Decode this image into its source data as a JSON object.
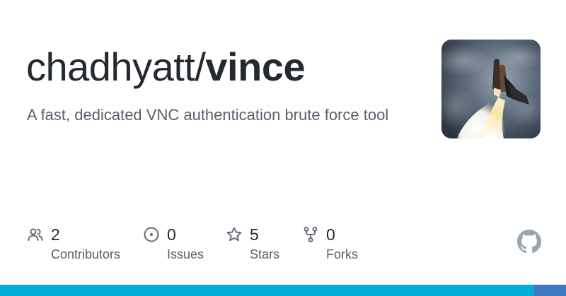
{
  "repo": {
    "owner": "chadhyatt/",
    "name": "vince",
    "description": "A fast, dedicated VNC authentication brute force tool"
  },
  "avatar": {
    "icon": "space-shuttle-launch-image"
  },
  "stats": [
    {
      "icon": "people-icon",
      "count": "2",
      "label": "Contributors"
    },
    {
      "icon": "issue-icon",
      "count": "0",
      "label": "Issues"
    },
    {
      "icon": "star-icon",
      "count": "5",
      "label": "Stars"
    },
    {
      "icon": "fork-icon",
      "count": "0",
      "label": "Forks"
    }
  ],
  "branding": {
    "icon": "github-mark-icon"
  },
  "colors": {
    "title": "#24292f",
    "muted": "#57606a",
    "icon": "#656d76",
    "language_bar_main": "#00add8",
    "language_bar_end": "#4078c0"
  }
}
